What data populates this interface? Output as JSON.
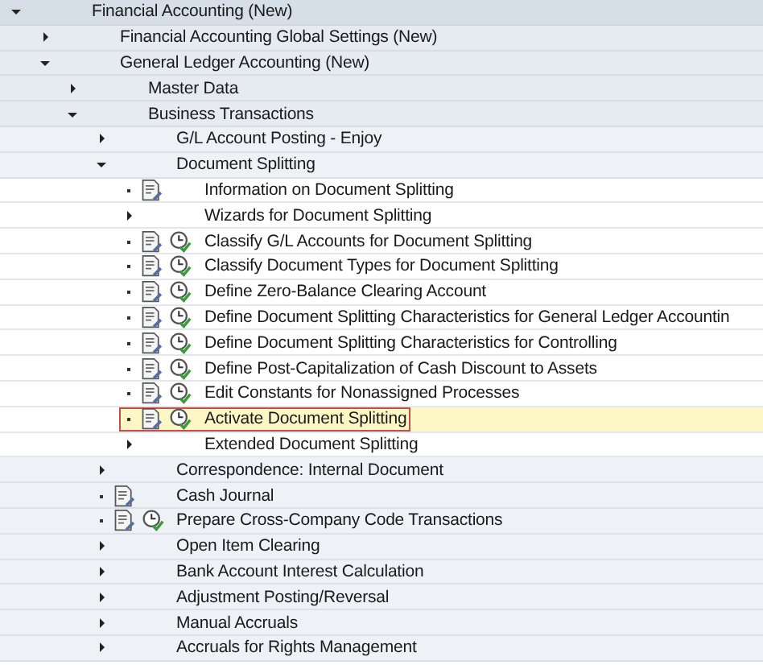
{
  "tree": [
    {
      "label": "Financial Accounting (New)",
      "kind": "folder",
      "expanded": true,
      "selected": false,
      "children": [
        {
          "label": "Financial Accounting Global Settings (New)",
          "kind": "folder",
          "expanded": false,
          "selected": false
        },
        {
          "label": "General Ledger Accounting (New)",
          "kind": "folder",
          "expanded": true,
          "selected": false,
          "children": [
            {
              "label": "Master Data",
              "kind": "folder",
              "expanded": false,
              "selected": false
            },
            {
              "label": "Business Transactions",
              "kind": "folder",
              "expanded": true,
              "selected": false,
              "children": [
                {
                  "label": "G/L Account Posting - Enjoy",
                  "kind": "folder",
                  "expanded": false,
                  "selected": false
                },
                {
                  "label": "Document Splitting",
                  "kind": "folder",
                  "expanded": true,
                  "selected": false,
                  "children": [
                    {
                      "label": "Information on Document Splitting",
                      "kind": "activity",
                      "doc": true,
                      "clock": false,
                      "selected": false
                    },
                    {
                      "label": "Wizards for Document Splitting",
                      "kind": "folder",
                      "expanded": false,
                      "selected": false
                    },
                    {
                      "label": "Classify G/L Accounts for Document Splitting",
                      "kind": "activity",
                      "doc": true,
                      "clock": true,
                      "selected": false
                    },
                    {
                      "label": "Classify Document Types for Document Splitting",
                      "kind": "activity",
                      "doc": true,
                      "clock": true,
                      "selected": false
                    },
                    {
                      "label": "Define Zero-Balance Clearing Account",
                      "kind": "activity",
                      "doc": true,
                      "clock": true,
                      "selected": false
                    },
                    {
                      "label": "Define Document Splitting Characteristics for General Ledger Accountin",
                      "kind": "activity",
                      "doc": true,
                      "clock": true,
                      "selected": false
                    },
                    {
                      "label": "Define Document Splitting Characteristics for Controlling",
                      "kind": "activity",
                      "doc": true,
                      "clock": true,
                      "selected": false
                    },
                    {
                      "label": "Define Post-Capitalization of Cash Discount to Assets",
                      "kind": "activity",
                      "doc": true,
                      "clock": true,
                      "selected": false
                    },
                    {
                      "label": "Edit Constants for Nonassigned Processes",
                      "kind": "activity",
                      "doc": true,
                      "clock": true,
                      "selected": false
                    },
                    {
                      "label": "Activate Document Splitting",
                      "kind": "activity",
                      "doc": true,
                      "clock": true,
                      "selected": true
                    },
                    {
                      "label": "Extended Document Splitting",
                      "kind": "folder",
                      "expanded": false,
                      "selected": false
                    }
                  ]
                },
                {
                  "label": "Correspondence: Internal Document",
                  "kind": "folder",
                  "expanded": false,
                  "selected": false
                },
                {
                  "label": "Cash Journal",
                  "kind": "activity",
                  "doc": true,
                  "clock": false,
                  "selected": false
                },
                {
                  "label": "Prepare Cross-Company Code Transactions",
                  "kind": "activity",
                  "doc": true,
                  "clock": true,
                  "selected": false
                },
                {
                  "label": "Open Item Clearing",
                  "kind": "folder",
                  "expanded": false,
                  "selected": false
                },
                {
                  "label": "Bank Account Interest Calculation",
                  "kind": "folder",
                  "expanded": false,
                  "selected": false
                },
                {
                  "label": "Adjustment Posting/Reversal",
                  "kind": "folder",
                  "expanded": false,
                  "selected": false
                },
                {
                  "label": "Manual Accruals",
                  "kind": "folder",
                  "expanded": false,
                  "selected": false
                },
                {
                  "label": "Accruals for Rights Management",
                  "kind": "folder",
                  "expanded": false,
                  "selected": false
                }
              ]
            }
          ]
        }
      ]
    }
  ]
}
